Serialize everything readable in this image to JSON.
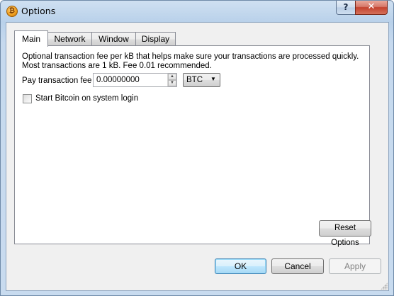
{
  "window": {
    "title": "Options",
    "app_icon": "bitcoin-icon",
    "help_label": "?",
    "close_label": "✕"
  },
  "tabs": [
    {
      "label": "Main",
      "selected": true
    },
    {
      "label": "Network",
      "selected": false
    },
    {
      "label": "Window",
      "selected": false
    },
    {
      "label": "Display",
      "selected": false
    }
  ],
  "main": {
    "description": "Optional transaction fee per kB that helps make sure your transactions are processed quickly. Most transactions are 1 kB. Fee 0.01 recommended.",
    "fee_label": "Pay transaction fee",
    "fee_value": "0.00000000",
    "fee_unit": "BTC",
    "startup_label": "Start Bitcoin on system login",
    "startup_checked": false,
    "reset_label": "Reset Options"
  },
  "buttons": {
    "ok": "OK",
    "cancel": "Cancel",
    "apply": "Apply"
  }
}
